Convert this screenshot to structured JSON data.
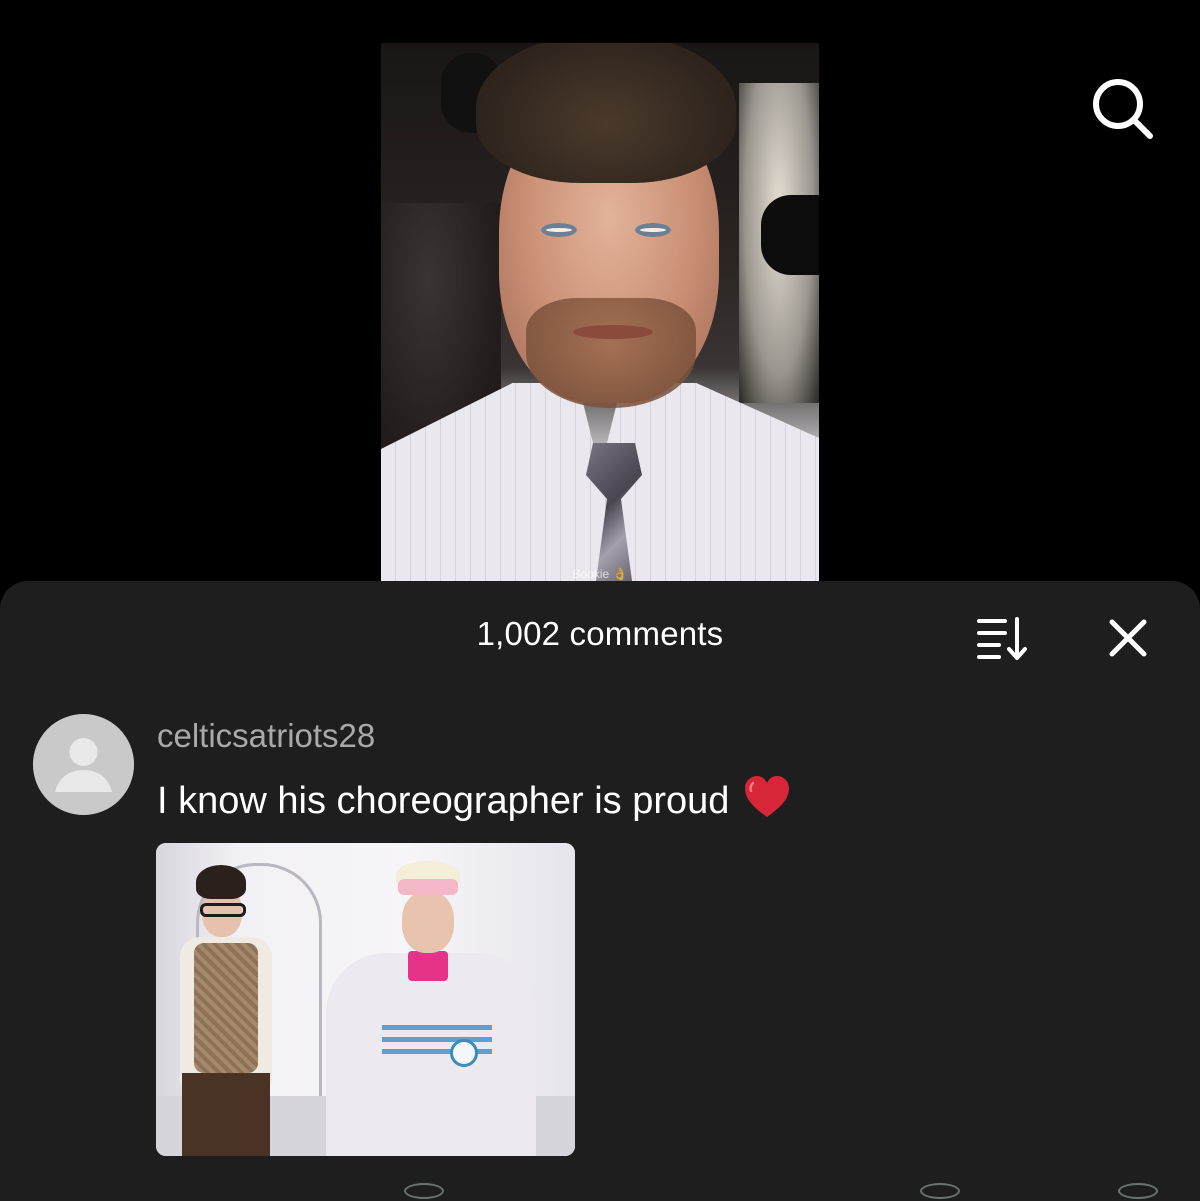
{
  "video": {
    "watermark": "Bookie 👌"
  },
  "header": {
    "search_icon": "search-icon"
  },
  "comments_sheet": {
    "count_label": "1,002 comments",
    "sort_icon": "sort-icon",
    "close_icon": "close-icon"
  },
  "comment": {
    "username": "celticsatriots28",
    "text": "I know his choreographer is proud",
    "emoji_icon": "red-heart-icon",
    "heart_color": "#d72638"
  }
}
